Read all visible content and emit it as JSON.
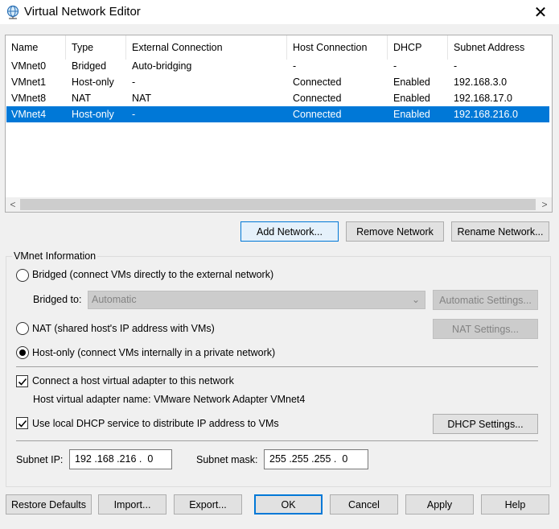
{
  "window": {
    "title": "Virtual Network Editor",
    "icon": "network-globe-icon",
    "close_glyph": "✕"
  },
  "table": {
    "columns": [
      "Name",
      "Type",
      "External Connection",
      "Host Connection",
      "DHCP",
      "Subnet Address"
    ],
    "rows": [
      {
        "name": "VMnet0",
        "type": "Bridged",
        "external": "Auto-bridging",
        "host": "-",
        "dhcp": "-",
        "subnet": "-"
      },
      {
        "name": "VMnet1",
        "type": "Host-only",
        "external": "-",
        "host": "Connected",
        "dhcp": "Enabled",
        "subnet": "192.168.3.0"
      },
      {
        "name": "VMnet8",
        "type": "NAT",
        "external": "NAT",
        "host": "Connected",
        "dhcp": "Enabled",
        "subnet": "192.168.17.0"
      },
      {
        "name": "VMnet4",
        "type": "Host-only",
        "external": "-",
        "host": "Connected",
        "dhcp": "Enabled",
        "subnet": "192.168.216.0"
      }
    ],
    "selected_row": 3,
    "selection_color": "#0078d7"
  },
  "table_buttons": {
    "add": "Add Network...",
    "remove": "Remove Network",
    "rename": "Rename Network..."
  },
  "vmnet_info": {
    "group_label": "VMnet Information",
    "bridged_label": "Bridged (connect VMs directly to the external network)",
    "bridged_to_label": "Bridged to:",
    "bridged_to_value": "Automatic",
    "auto_settings": "Automatic Settings...",
    "nat_label": "NAT (shared host's IP address with VMs)",
    "nat_settings": "NAT Settings...",
    "hostonly_label": "Host-only (connect VMs internally in a private network)",
    "selected_mode": "host-only",
    "connect_adapter_label": "Connect a host virtual adapter to this network",
    "connect_adapter_checked": true,
    "adapter_name_text": "Host virtual adapter name: VMware Network Adapter VMnet4",
    "dhcp_label": "Use local DHCP service to distribute IP address to VMs",
    "dhcp_checked": true,
    "dhcp_settings": "DHCP Settings...",
    "subnet_ip_label": "Subnet IP:",
    "subnet_ip_value": "192 .168 .216 .  0",
    "subnet_mask_label": "Subnet mask:",
    "subnet_mask_value": "255 .255 .255 .  0"
  },
  "footer": {
    "restore": "Restore Defaults",
    "import": "Import...",
    "export": "Export...",
    "ok": "OK",
    "cancel": "Cancel",
    "apply": "Apply",
    "help": "Help"
  }
}
